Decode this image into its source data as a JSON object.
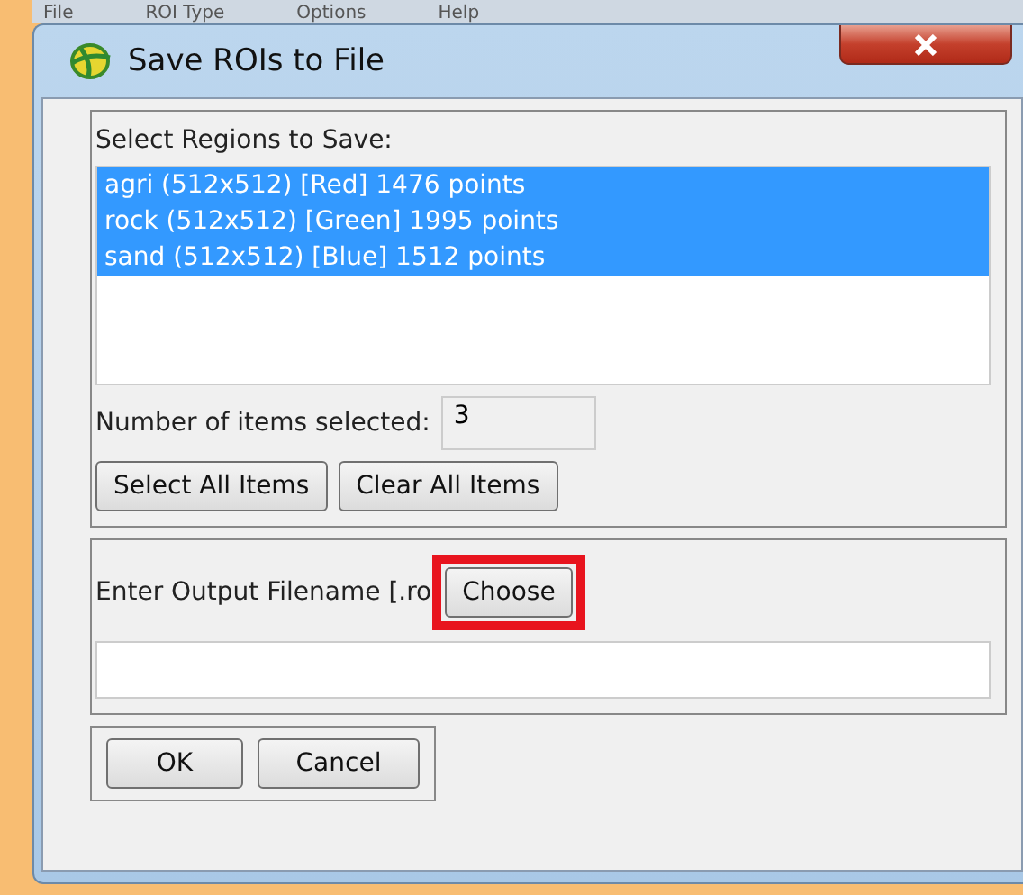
{
  "background_menu": [
    "File",
    "ROI Type",
    "Options",
    "Help"
  ],
  "window": {
    "title": "Save ROIs to File"
  },
  "regions": {
    "label": "Select Regions to Save:",
    "items": [
      {
        "text": "agri (512x512) [Red] 1476 points",
        "selected": true
      },
      {
        "text": "rock (512x512) [Green] 1995 points",
        "selected": true
      },
      {
        "text": "sand (512x512) [Blue] 1512 points",
        "selected": true
      }
    ]
  },
  "count": {
    "label": "Number of items selected:",
    "value": "3"
  },
  "list_buttons": [
    "Select All Items",
    "Clear All Items"
  ],
  "output": {
    "label": "Enter Output Filename [.ro",
    "choose": "Choose",
    "highlighted": true
  },
  "buttons": [
    "OK",
    "Cancel"
  ]
}
